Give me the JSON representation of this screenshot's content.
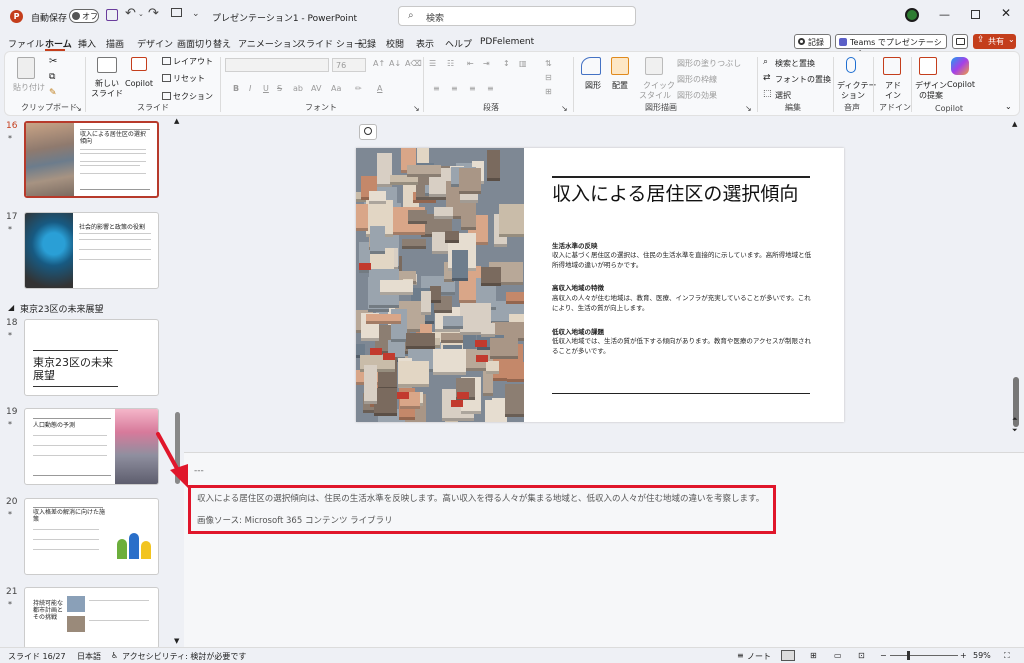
{
  "titlebar": {
    "autosave_label": "自動保存",
    "autosave_state": "オフ",
    "doc_title": "プレゼンテーション1 - PowerPoint",
    "search_placeholder": "検索"
  },
  "menu": [
    "ファイル",
    "ホーム",
    "挿入",
    "描画",
    "デザイン",
    "画面切り替え",
    "アニメーション",
    "スライド ショー",
    "記録",
    "校閲",
    "表示",
    "ヘルプ",
    "PDFelement"
  ],
  "menu_right": {
    "record": "記録",
    "teams": "Teams でプレゼンテーション",
    "share": "共有"
  },
  "ribbon": {
    "clipboard": {
      "paste": "貼り付け",
      "group": "クリップボード"
    },
    "slides": {
      "new_slide": "新しい",
      "new_slide2": "スライド",
      "copilot": "Copilot",
      "layout": "レイアウト",
      "reset": "リセット",
      "section": "セクション",
      "group": "スライド"
    },
    "font": {
      "size": "76",
      "group": "フォント"
    },
    "paragraph": {
      "group": "段落"
    },
    "drawing": {
      "shape": "図形",
      "arrange": "配置",
      "quick_style": "クイック",
      "quick_style2": "スタイル",
      "fill": "図形の塗りつぶし",
      "outline": "図形の枠線",
      "effect": "図形の効果",
      "group": "図形描画"
    },
    "editing": {
      "find_replace": "検索と置換",
      "replace_font": "フォントの置換",
      "select": "選択",
      "group": "編集"
    },
    "voice": {
      "dictate": "ディクテー",
      "dictate2": "ション",
      "group": "音声"
    },
    "addin": {
      "addin": "アド",
      "addin2": "イン",
      "group": "アドイン"
    },
    "copilot": {
      "design": "デザイン",
      "design2": "の提案",
      "copilot": "Copilot",
      "group": "Copilot"
    }
  },
  "thumbnails": [
    {
      "num": "16",
      "star": "*",
      "title": "収入による居住区の選択傾向"
    },
    {
      "num": "17",
      "star": "*",
      "title": "社会的影響と政策の役割"
    },
    {
      "section": "東京23区の未来展望"
    },
    {
      "num": "18",
      "star": "*",
      "title": "東京23区の未来展望"
    },
    {
      "num": "19",
      "star": "*",
      "title": "人口動態の予測"
    },
    {
      "num": "20",
      "star": "*",
      "title": "収入格差の解消に向けた施策"
    },
    {
      "num": "21",
      "star": "*",
      "title": "持続可能な都市計画とその挑戦"
    }
  ],
  "slide": {
    "title": "収入による居住区の選択傾向",
    "h1": "生活水準の反映",
    "p1": "収入に基づく居住区の選択は、住民の生活水準を直接的に示しています。高所得地域と低所得地域の違いが明らかです。",
    "h2": "高収入地域の特徴",
    "p2": "高収入の人々が住む地域は、教育、医療、インフラが充実していることが多いです。これにより、生活の質が向上します。",
    "h3": "低収入地域の課題",
    "p3": "低収入地域では、生活の質が低下する傾向があります。教育や医療のアクセスが制限されることが多いです。"
  },
  "notes": {
    "dashes": "---",
    "line1": "収入による居住区の選択傾向は、住民の生活水準を反映します。高い収入を得る人々が集まる地域と、低収入の人々が住む地域の違いを考察します。",
    "line2": "画像ソース: Microsoft 365 コンテンツ ライブラリ"
  },
  "status": {
    "slide": "スライド 16/27",
    "lang": "日本語",
    "accessibility": "アクセシビリティ: 検討が必要です",
    "notes": "ノート",
    "zoom": "59%"
  },
  "colors": {
    "accent": "#c43e1c",
    "callout": "#e0162b"
  }
}
